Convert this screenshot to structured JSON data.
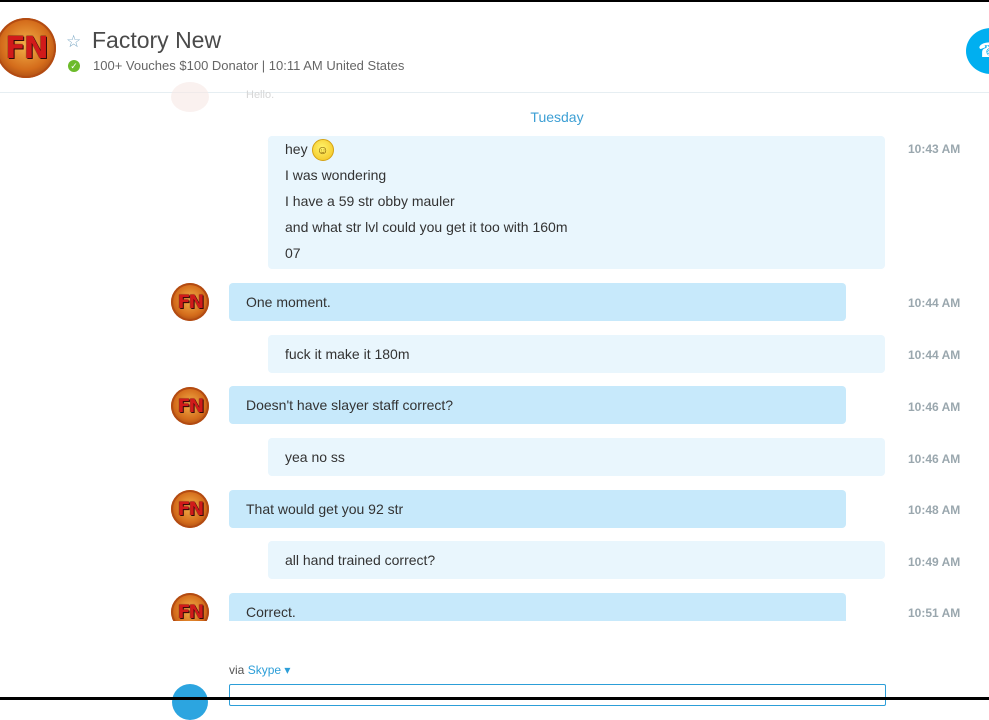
{
  "header": {
    "contact_name": "Factory New",
    "avatar_initials": "FN",
    "mood": "100+ Vouches $100 Donator  |  10:11 AM United States",
    "star_icon": "star-outline-icon",
    "status_icon": "online-check-icon"
  },
  "faded_prev": {
    "text": "Hello."
  },
  "day_divider": "Tuesday",
  "messages": [
    {
      "from": "me",
      "lines": [
        "hey",
        "I was wondering",
        "I have a 59 str obby mauler",
        "and what str lvl could you get it too with 160m",
        "07"
      ],
      "time": "10:43 AM",
      "has_emoji": true
    },
    {
      "from": "them",
      "lines": [
        "One moment."
      ],
      "time": "10:44 AM"
    },
    {
      "from": "me",
      "lines": [
        "fuck it make it 180m"
      ],
      "time": "10:44 AM"
    },
    {
      "from": "them",
      "lines": [
        "Doesn't have slayer staff correct?"
      ],
      "time": "10:46 AM"
    },
    {
      "from": "me",
      "lines": [
        "yea no ss"
      ],
      "time": "10:46 AM"
    },
    {
      "from": "them",
      "lines": [
        "That would get you 92 str"
      ],
      "time": "10:48 AM"
    },
    {
      "from": "me",
      "lines": [
        "all hand trained correct?"
      ],
      "time": "10:49 AM"
    },
    {
      "from": "them",
      "lines": [
        "Correct."
      ],
      "time": "10:51 AM"
    }
  ],
  "composer": {
    "via_label": "via",
    "via_service": "Skype ▾"
  },
  "colors": {
    "accent": "#00aff0",
    "incoming_bubble": "#c7e9fb",
    "outgoing_bubble": "#e9f6fd",
    "timestamp": "#9aa7ae",
    "online": "#6cbb2a"
  }
}
